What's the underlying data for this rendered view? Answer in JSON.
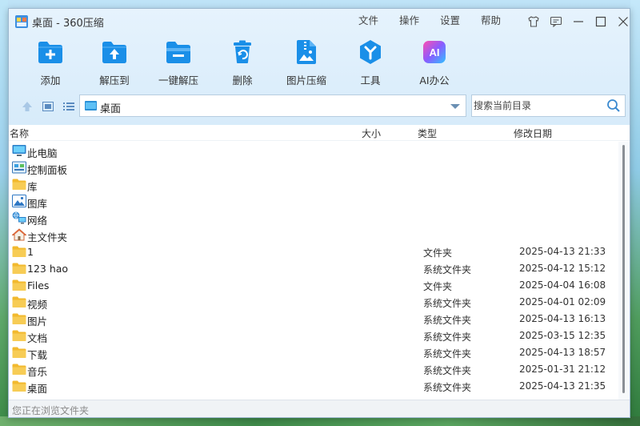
{
  "window": {
    "title": "桌面 - 360压缩"
  },
  "menu": [
    "文件",
    "操作",
    "设置",
    "帮助"
  ],
  "title_icons": [
    "shirt-icon",
    "feedback-icon",
    "minimize-icon",
    "maximize-icon",
    "close-icon"
  ],
  "toolbar": [
    {
      "label": "添加",
      "icon": "add-folder-icon"
    },
    {
      "label": "解压到",
      "icon": "extract-to-icon"
    },
    {
      "label": "一键解压",
      "icon": "one-click-extract-icon"
    },
    {
      "label": "删除",
      "icon": "delete-icon"
    },
    {
      "label": "图片压缩",
      "icon": "image-compress-icon"
    },
    {
      "label": "工具",
      "icon": "tools-icon"
    },
    {
      "label": "AI办公",
      "icon": "ai-office-icon",
      "badge": "AI"
    }
  ],
  "address": {
    "path": "桌面"
  },
  "search": {
    "placeholder": "搜索当前目录"
  },
  "columns": {
    "name": "名称",
    "size": "大小",
    "type": "类型",
    "modified": "修改日期"
  },
  "rows": [
    {
      "name": "此电脑",
      "type": "",
      "date": "",
      "icon": "computer-icon"
    },
    {
      "name": "控制面板",
      "type": "",
      "date": "",
      "icon": "control-panel-icon"
    },
    {
      "name": "库",
      "type": "",
      "date": "",
      "icon": "folder-icon"
    },
    {
      "name": "图库",
      "type": "",
      "date": "",
      "icon": "gallery-icon"
    },
    {
      "name": "网络",
      "type": "",
      "date": "",
      "icon": "network-icon"
    },
    {
      "name": "主文件夹",
      "type": "",
      "date": "",
      "icon": "home-icon"
    },
    {
      "name": "1",
      "type": "文件夹",
      "date": "2025-04-13 21:33",
      "icon": "folder-icon"
    },
    {
      "name": "123 hao",
      "type": "系统文件夹",
      "date": "2025-04-12 15:12",
      "icon": "folder-icon"
    },
    {
      "name": "Files",
      "type": "文件夹",
      "date": "2025-04-04 16:08",
      "icon": "folder-icon"
    },
    {
      "name": "视频",
      "type": "系统文件夹",
      "date": "2025-04-01 02:09",
      "icon": "folder-icon"
    },
    {
      "name": "图片",
      "type": "系统文件夹",
      "date": "2025-04-13 16:13",
      "icon": "folder-icon"
    },
    {
      "name": "文档",
      "type": "系统文件夹",
      "date": "2025-03-15 12:35",
      "icon": "folder-icon"
    },
    {
      "name": "下载",
      "type": "系统文件夹",
      "date": "2025-04-13 18:57",
      "icon": "folder-icon"
    },
    {
      "name": "音乐",
      "type": "系统文件夹",
      "date": "2025-01-31 21:12",
      "icon": "folder-icon"
    },
    {
      "name": "桌面",
      "type": "系统文件夹",
      "date": "2025-04-13 21:35",
      "icon": "folder-icon"
    }
  ],
  "status": {
    "text": "您正在浏览文件夹"
  },
  "colors": {
    "accent": "#1a8fe8",
    "chrome": "#dcecfb",
    "folder": "#f7c948"
  }
}
